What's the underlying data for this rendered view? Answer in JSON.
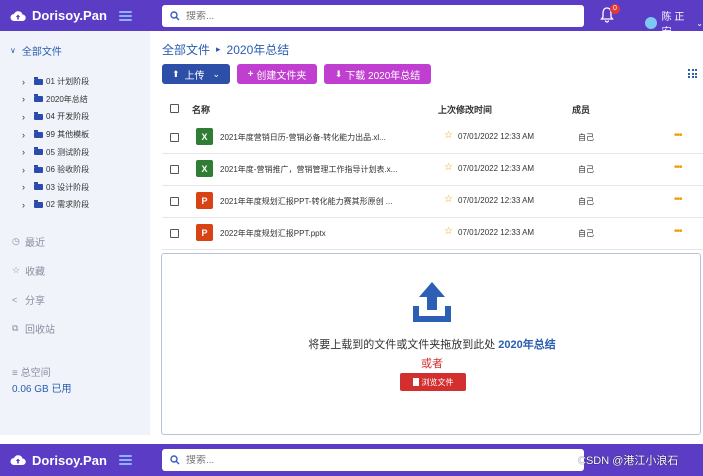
{
  "app": {
    "brand": "Dorisoy.Pan"
  },
  "search": {
    "placeholder": "搜索..."
  },
  "notifications": {
    "count": "0"
  },
  "user": {
    "name": "陈 正宏"
  },
  "sidebar": {
    "root_label": "全部文件",
    "folders": [
      {
        "label": "01 计划阶段"
      },
      {
        "label": "2020年总结"
      },
      {
        "label": "04 开发阶段"
      },
      {
        "label": "99 其他模板"
      },
      {
        "label": "05 测试阶段"
      },
      {
        "label": "06 验收阶段"
      },
      {
        "label": "03 设计阶段"
      },
      {
        "label": "02 需求阶段"
      }
    ],
    "nav": [
      {
        "label": "最近",
        "icon": "clock-icon"
      },
      {
        "label": "收藏",
        "icon": "star-icon"
      },
      {
        "label": "分享",
        "icon": "share-icon"
      },
      {
        "label": "回收站",
        "icon": "recycle-icon"
      }
    ],
    "storage_label": "总空间",
    "storage_used": "0.06 GB 已用"
  },
  "breadcrumb": {
    "root": "全部文件",
    "current": "2020年总结"
  },
  "toolbar": {
    "upload_label": "上传",
    "new_folder_label": "创建文件夹",
    "download_label": "下载 2020年总结"
  },
  "table": {
    "headers": {
      "name": "名称",
      "modified": "上次修改时间",
      "member": "成员"
    },
    "rows": [
      {
        "type": "excel",
        "name": "2021年度营销日历-营销必备-转化能力出品.xl...",
        "modified": "07/01/2022 12:33 AM",
        "member": "自己"
      },
      {
        "type": "excel",
        "name": "2021年度-营销推广，营销管理工作指导计划表.x...",
        "modified": "07/01/2022 12:33 AM",
        "member": "自己"
      },
      {
        "type": "ppt",
        "name": "2021年年度规划汇报PPT-转化能力赛其形原创 ...",
        "modified": "07/01/2022 12:33 AM",
        "member": "自己"
      },
      {
        "type": "ppt",
        "name": "2022年年度规划汇报PPT.pptx",
        "modified": "07/01/2022 12:33 AM",
        "member": "自己"
      }
    ]
  },
  "dropzone": {
    "text": "将要上载到的文件或文件夹拖放到此处",
    "target": "2020年总结",
    "or": "或者",
    "browse_label": "浏览文件"
  },
  "watermark": "CSDN @港江小浪石",
  "colors": {
    "topbar": "#5b3cc4",
    "primary": "#2d4fa8",
    "accent": "#c13fd0",
    "danger": "#d32f2f"
  }
}
